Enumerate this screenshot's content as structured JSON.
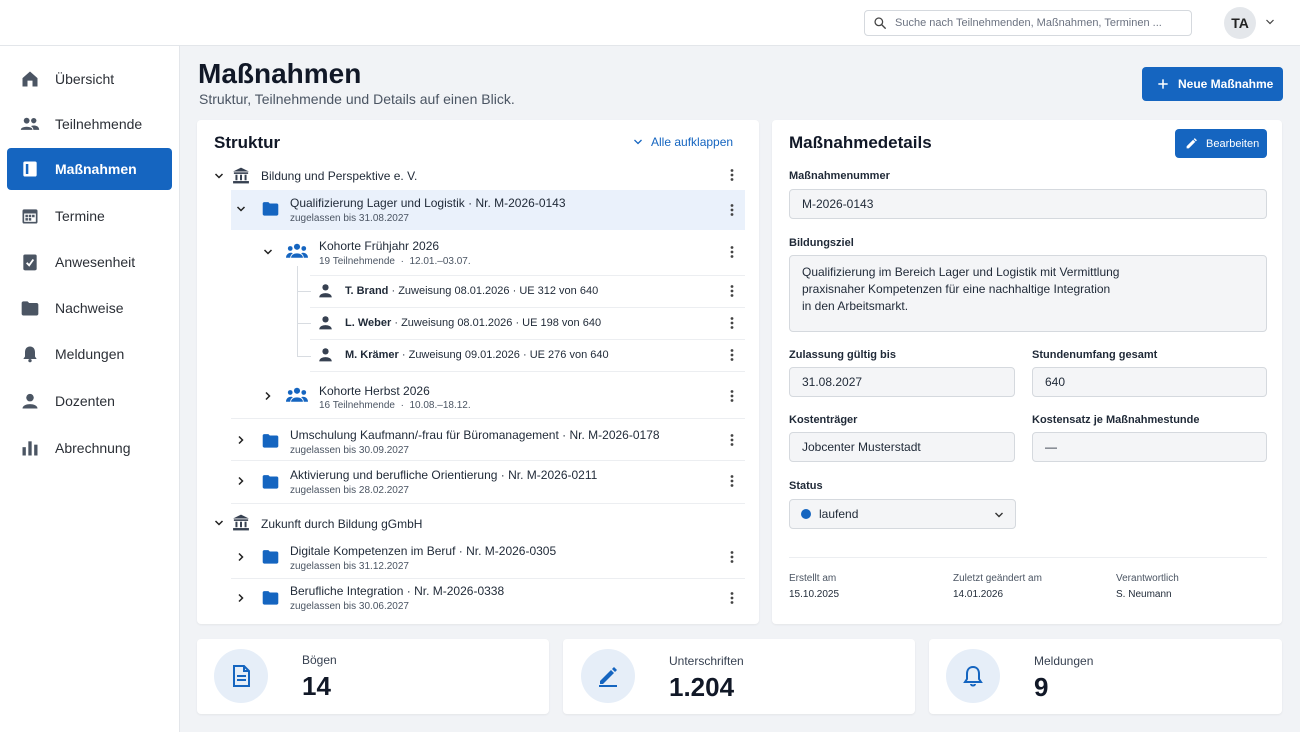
{
  "colors": {
    "accent": "#1565c0",
    "selected_row": "#eaf1fb",
    "background": "#f1f3f6"
  },
  "header": {
    "search": {
      "placeholder": "Suche nach Teilnehmenden, Maßnahmen, Terminen ..."
    },
    "avatar": "TA"
  },
  "sidebar": {
    "items": [
      {
        "label": "Übersicht",
        "icon": "home-icon"
      },
      {
        "label": "Teilnehmende",
        "icon": "people-icon"
      },
      {
        "label": "Maßnahmen",
        "icon": "book-icon",
        "active": true
      },
      {
        "label": "Termine",
        "icon": "calendar-icon"
      },
      {
        "label": "Anwesenheit",
        "icon": "clipboard-check-icon"
      },
      {
        "label": "Nachweise",
        "icon": "folder-icon"
      },
      {
        "label": "Meldungen",
        "icon": "bell-icon"
      },
      {
        "label": "Dozenten",
        "icon": "person-icon"
      },
      {
        "label": "Abrechnung",
        "icon": "bar-chart-icon"
      }
    ]
  },
  "page": {
    "title": "Maßnahmen",
    "subtitle": "Struktur, Teilnehmende und Details auf einen Blick.",
    "new_button": "Neue Maßnahme"
  },
  "structure": {
    "title": "Struktur",
    "expand_all": "Alle aufklappen",
    "orgs": [
      {
        "name": "Bildung und Perspektive e. V."
      },
      {
        "name": "Zukunft durch Bildung gGmbH"
      }
    ],
    "measures": [
      {
        "title": "Qualifizierung Lager und Logistik",
        "nr": "Nr. M-2026-0143",
        "sub": "zugelassen bis 31.08.2027"
      },
      {
        "title": "Umschulung Kaufmann/-frau für Büromanagement",
        "nr": "Nr. M-2026-0178",
        "sub": "zugelassen bis 30.09.2027"
      },
      {
        "title": "Aktivierung und berufliche Orientierung",
        "nr": "Nr. M-2026-0211",
        "sub": "zugelassen bis 28.02.2027"
      },
      {
        "title": "Digitale Kompetenzen im Beruf",
        "nr": "Nr. M-2026-0305",
        "sub": "zugelassen bis 31.12.2027"
      },
      {
        "title": "Berufliche Integration",
        "nr": "Nr. M-2026-0338",
        "sub": "zugelassen bis 30.06.2027"
      }
    ],
    "cohorts": [
      {
        "title": "Kohorte Frühjahr 2026",
        "count": "19 Teilnehmende",
        "period": "12.01.–03.07."
      },
      {
        "title": "Kohorte Herbst 2026",
        "count": "16 Teilnehmende",
        "period": "10.08.–18.12."
      }
    ],
    "participants": [
      {
        "name": "T. Brand",
        "assign": "Zuweisung 08.01.2026",
        "ue": "UE 312 von 640"
      },
      {
        "name": "L. Weber",
        "assign": "Zuweisung 08.01.2026",
        "ue": "UE 198 von 640"
      },
      {
        "name": "M. Krämer",
        "assign": "Zuweisung 09.01.2026",
        "ue": "UE 276 von 640"
      }
    ],
    "separator": "·"
  },
  "details": {
    "title": "Maßnahmedetails",
    "edit_button": "Bearbeiten",
    "nr_label": "Maßnahmenummer",
    "nr_value": "M-2026-0143",
    "goal_label": "Bildungsziel",
    "goal_value": "Qualifizierung im Bereich Lager und Logistik mit Vermittlung\npraxisnaher Kompetenzen für eine nachhaltige Integration\nin den Arbeitsmarkt.",
    "valid_label": "Zulassung gültig bis",
    "valid_value": "31.08.2027",
    "hours_label": "Stundenumfang gesamt",
    "hours_value": "640",
    "payer_label": "Kostenträger",
    "payer_value": "Jobcenter Musterstadt",
    "rate_label": "Kostensatz je Maßnahmestunde",
    "rate_value": "—",
    "status_label": "Status",
    "status_value": "laufend",
    "created_label": "Erstellt am",
    "created_value": "15.10.2025",
    "changed_label": "Zuletzt geändert am",
    "changed_value": "14.01.2026",
    "owner_label": "Verantwortlich",
    "owner_value": "S. Neumann"
  },
  "stats": [
    {
      "label": "Bögen",
      "value": "14",
      "icon": "document-icon"
    },
    {
      "label": "Unterschriften",
      "value": "1.204",
      "icon": "pen-icon"
    },
    {
      "label": "Meldungen",
      "value": "9",
      "icon": "bell-icon"
    }
  ]
}
